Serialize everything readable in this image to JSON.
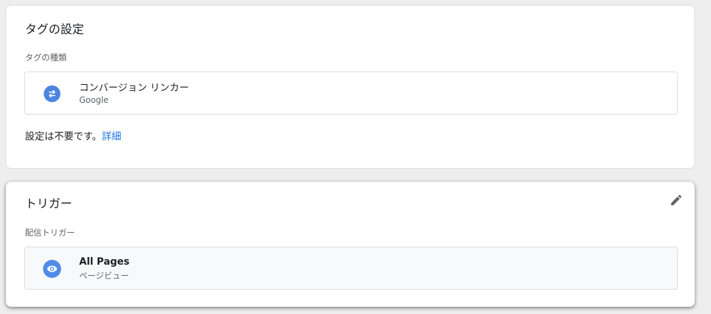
{
  "tag_config": {
    "title": "タグの設定",
    "type_label": "タグの種類",
    "item": {
      "name": "コンバージョン リンカー",
      "provider": "Google",
      "icon": "swap-arrows-icon"
    },
    "note_text": "設定は不要です。",
    "note_link": "詳細"
  },
  "trigger": {
    "title": "トリガー",
    "section_label": "配信トリガー",
    "item": {
      "name": "All Pages",
      "type": "ページビュー",
      "icon": "eye-icon"
    },
    "edit_icon": "pencil-icon"
  },
  "colors": {
    "accent": "#1a73e8",
    "icon_bg": "#4e84e0"
  }
}
